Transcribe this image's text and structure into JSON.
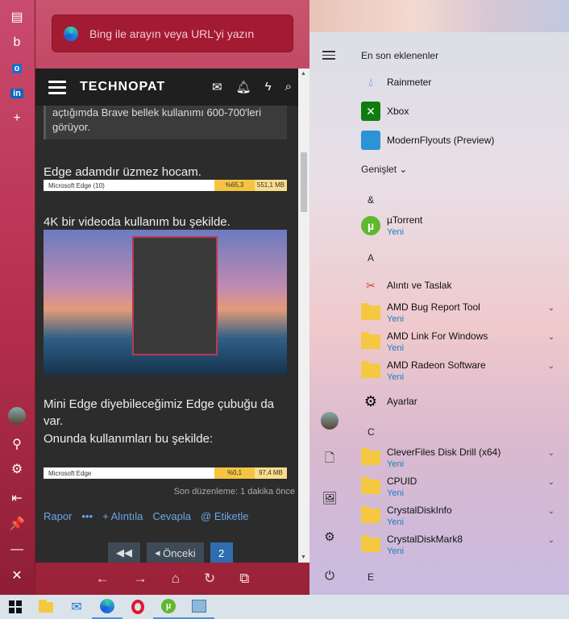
{
  "edge": {
    "address_placeholder": "Bing ile arayın veya URL'yi yazın",
    "sidebar_icons": [
      "news-icon",
      "bing-icon",
      "outlook-icon",
      "linkedin-icon",
      "plus-icon"
    ],
    "sidebar_bottom_icons": [
      "avatar",
      "games-icon",
      "settings-icon",
      "collapse-icon",
      "pin-icon",
      "minimize-icon",
      "close-icon"
    ]
  },
  "page": {
    "logo": "TECHNOPAT",
    "quote_text": "açtığımda Brave bellek kullanımı 600-700'leri görüyor.",
    "p1": "Edge adamdır üzmez hocam.",
    "bar1": {
      "name": "Microsoft Edge (10)",
      "cpu": "%65,3",
      "mem": "551,1 MB"
    },
    "p2": "4K bir videoda kullanım bu şekilde.",
    "p3_line1": "Mini Edge diyebileceğimiz Edge çubuğu da",
    "p3_line2": "var.",
    "p3_line3": "Onunda kullanımları bu şekilde:",
    "bar2": {
      "name": "Microsoft Edge",
      "cpu": "%0,1",
      "mem": "97,4 MB"
    },
    "edited": "Son düzenleme: 1 dakika önce",
    "actions": {
      "report": "Rapor",
      "more": "•••",
      "quote": "+ Alıntıla",
      "reply": "Cevapla",
      "tag": "@ Etiketle"
    },
    "pagination": {
      "prev": "Önceki",
      "page": "2"
    }
  },
  "start": {
    "recent_header": "En son eklenenler",
    "recent": [
      {
        "name": "Rainmeter",
        "icon": "rainmeter-icon"
      },
      {
        "name": "Xbox",
        "icon": "xbox-icon"
      },
      {
        "name": "ModernFlyouts (Preview)",
        "icon": "modernflyouts-icon"
      }
    ],
    "expand": "Genişlet",
    "groups": [
      {
        "letter": "&"
      },
      {
        "letter": "A"
      },
      {
        "letter": "C"
      },
      {
        "letter": "E"
      }
    ],
    "apps": [
      {
        "name": "µTorrent",
        "sub": "Yeni"
      },
      {
        "name": "Alıntı ve Taslak",
        "sub": ""
      },
      {
        "name": "AMD Bug Report Tool",
        "sub": "Yeni"
      },
      {
        "name": "AMD Link For Windows",
        "sub": "Yeni"
      },
      {
        "name": "AMD Radeon Software",
        "sub": "Yeni"
      },
      {
        "name": "Ayarlar",
        "sub": ""
      },
      {
        "name": "CleverFiles Disk Drill (x64)",
        "sub": "Yeni"
      },
      {
        "name": "CPUID",
        "sub": "Yeni"
      },
      {
        "name": "CrystalDiskInfo",
        "sub": "Yeni"
      },
      {
        "name": "CrystalDiskMark8",
        "sub": "Yeni"
      }
    ]
  },
  "taskbar": [
    "start-icon",
    "file-explorer-icon",
    "mail-icon",
    "edge-icon",
    "opera-icon",
    "utorrent-icon",
    "task-manager-icon"
  ]
}
